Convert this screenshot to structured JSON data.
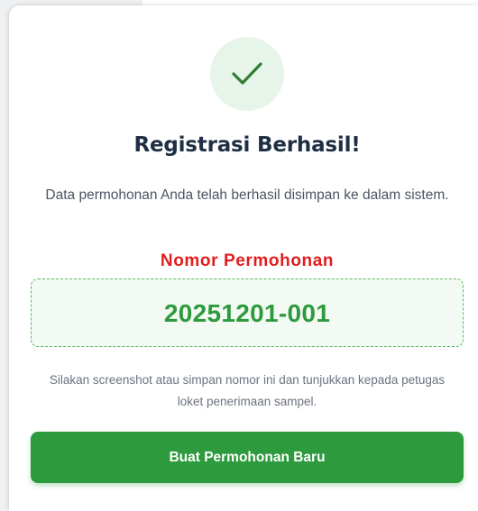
{
  "success": {
    "icon": "check-icon",
    "title": "Registrasi Berhasil!",
    "description": "Data permohonan Anda telah berhasil disimpan ke dalam sistem.",
    "number_label": "Nomor Permohonan",
    "number_value": "20251201-001",
    "hint": "Silakan screenshot atau simpan nomor ini dan tunjukkan kepada petugas loket penerimaan sampel.",
    "button_label": "Buat Permohonan Baru"
  },
  "colors": {
    "accent_green": "#2e9a3e",
    "label_red": "#e11d1d",
    "title_dark": "#1f2f43",
    "icon_bg": "#e6f4ea"
  }
}
